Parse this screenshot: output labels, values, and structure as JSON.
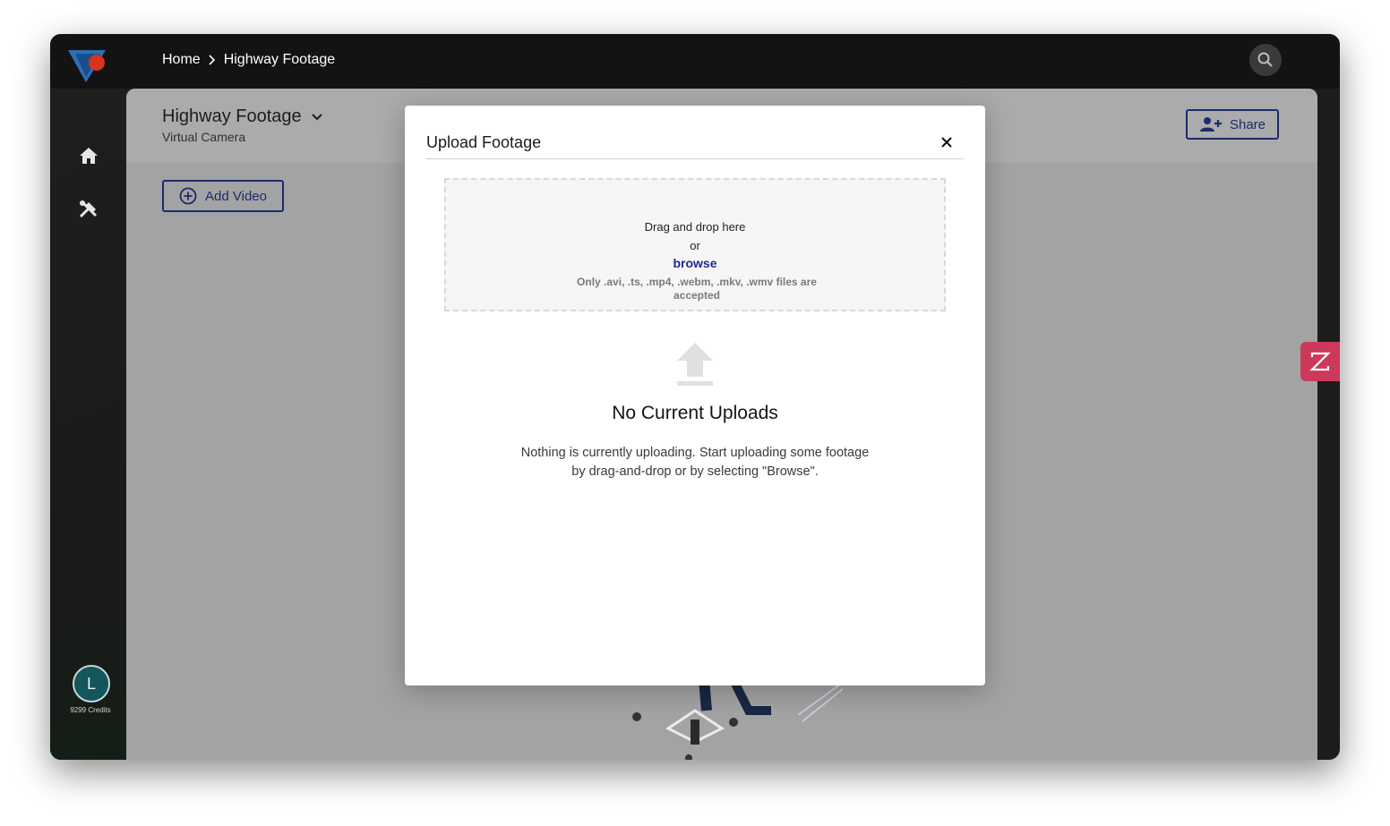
{
  "breadcrumb": {
    "home": "Home",
    "current": "Highway Footage"
  },
  "page": {
    "title": "Highway Footage",
    "subtitle": "Virtual Camera"
  },
  "toolbar": {
    "share_label": "Share",
    "add_video_label": "Add Video"
  },
  "user": {
    "avatar_initial": "L",
    "credits": "9299 Credits"
  },
  "modal": {
    "title": "Upload Footage",
    "dropzone": {
      "line1": "Drag and drop here",
      "or": "or",
      "browse": "browse",
      "note": "Only .avi, .ts, .mp4, .webm, .mkv, .wmv files are accepted"
    },
    "empty_title": "No Current Uploads",
    "empty_desc": "Nothing is currently uploading. Start uploading some footage by drag-and-drop or by selecting \"Browse\"."
  },
  "icons": [
    "logo",
    "chevron-right-icon",
    "search-icon",
    "home-icon",
    "tools-icon",
    "chevron-down-icon",
    "add-user-icon",
    "plus-circle-icon",
    "close-icon",
    "upload-icon",
    "side-widget-icon"
  ],
  "colors": {
    "accent": "#1d2a6a",
    "widget": "#cc3a5b",
    "avatar": "#15555c"
  }
}
